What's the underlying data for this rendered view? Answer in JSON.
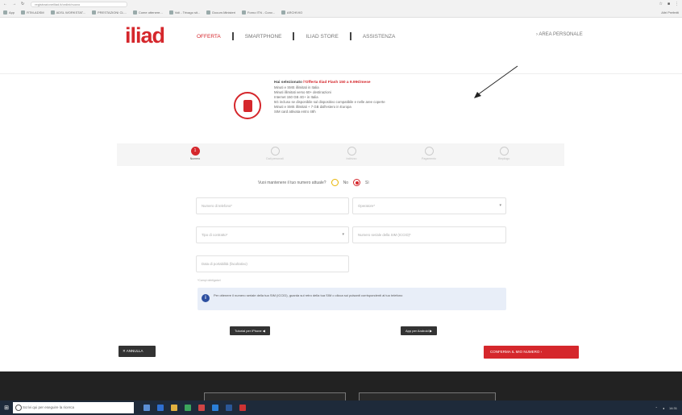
{
  "browser": {
    "url": "registrazioneiliad.it/ordini/nuovo",
    "bookmarks": [
      "App",
      "RTM-ADSM",
      "ADSL WORKSTAT...",
      "PRESTAZIONI CL...",
      "Come ottenere...",
      "Voli - Trivago sit...",
      "Docum.Ministeri",
      "Forno ITN - Conv...",
      "ARCHIVIO"
    ],
    "bookmarks_right": "Altri Preferiti"
  },
  "header": {
    "logo": "iliad",
    "menu": [
      "OFFERTA",
      "SMARTPHONE",
      "ILIAD STORE",
      "ASSISTENZA"
    ],
    "area_personale": "AREA PERSONALE"
  },
  "offer": {
    "headline_prefix": "Hai selezionato ",
    "headline_offer": "l'Offerta Iliad Flash 150 a 9.99€/mese",
    "lines": [
      "Minuti e SMS illimitati in Italia",
      "Minuti illimitati verso 60+ destinazioni",
      "Internet 150 GB 4G+ in Italia",
      "5G incluso se disponibile sul dispositivo compatibile e nelle aree coperte",
      "Minuti e SMS illimitati + 7 GB dall'estero in Europa",
      "SIM card attivata entro 48h"
    ]
  },
  "steps": [
    {
      "num": "1",
      "label": "Numero",
      "active": true
    },
    {
      "num": "",
      "label": "Dati personali",
      "active": false
    },
    {
      "num": "",
      "label": "Indirizzo",
      "active": false
    },
    {
      "num": "",
      "label": "Pagamento",
      "active": false
    },
    {
      "num": "",
      "label": "Riepilogo",
      "active": false
    }
  ],
  "form": {
    "question": "Vuoi mantenere il tuo numero attuale?",
    "option_no": "No",
    "option_yes": "Sì",
    "phone_placeholder": "Numero di telefono*",
    "operator_placeholder": "Operatore*",
    "contract_placeholder": "Tipo di contratto*",
    "iccid_placeholder": "Numero seriale della SIM (ICCID)*",
    "date_placeholder": "Data di portabilità (facoltativo)",
    "required_note": "*Campi obbligatori",
    "info_text": "Per ottenere il numero seriale della tua SIM (ICCID), guarda sul retro della tua SIM o clicca sui pulsanti corrispondenti al tuo telefono"
  },
  "tutorials": {
    "iphone": "Tutorial per iPhone",
    "android": "App per Android"
  },
  "actions": {
    "cancel": "ANNULLA",
    "confirm": "CONFERMA IL MIO NUMERO"
  },
  "taskbar": {
    "search_placeholder": "Scrivi qui per eseguire la ricerca",
    "time": "14:31"
  },
  "colors": {
    "brand": "#d5272c",
    "info_bg": "#e8eef8"
  }
}
